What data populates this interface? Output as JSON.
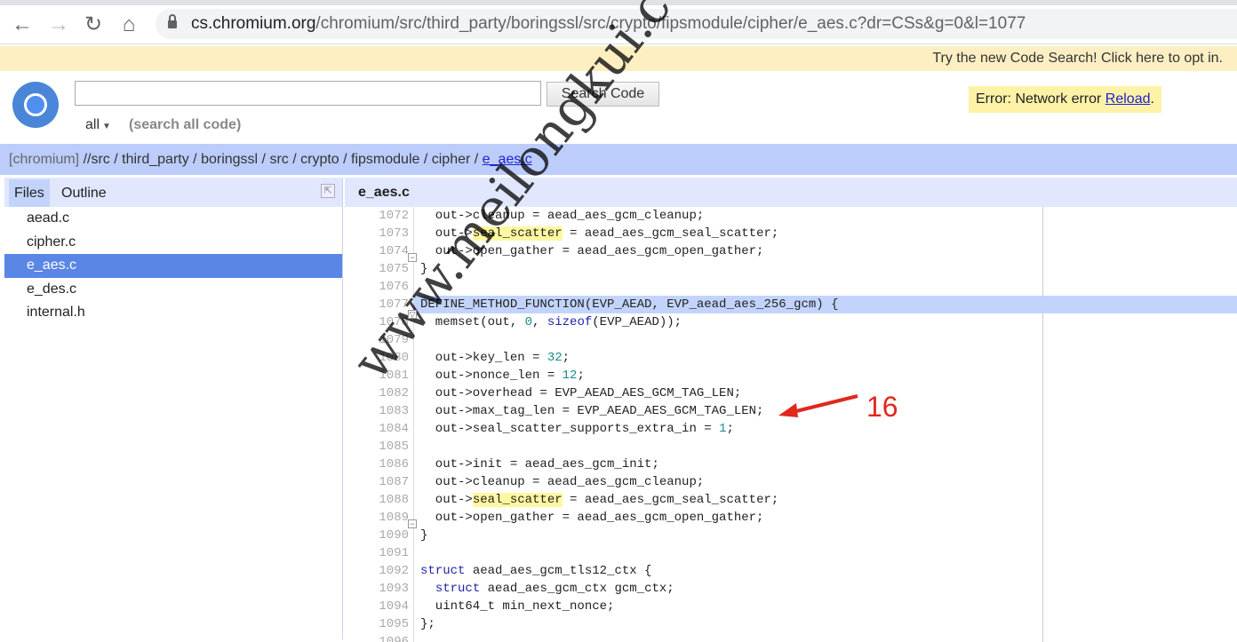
{
  "browser": {
    "url_host": "cs.chromium.org",
    "url_path": "/chromium/src/third_party/boringssl/src/crypto/fipsmodule/cipher/e_aes.c?dr=CSs&g=0&l=1077"
  },
  "banner": "Try the new Code Search! Click here to opt in.",
  "search": {
    "value": "",
    "button": "Search Code",
    "scope": "all",
    "hint": "(search all code)"
  },
  "error": {
    "text": "Error: Network error ",
    "link": "Reload",
    "suffix": "."
  },
  "breadcrumb": {
    "root": "[chromium]",
    "parts": [
      " //src",
      " / third_party",
      " / boringssl",
      " / src",
      " / crypto",
      " / fipsmodule",
      " / cipher",
      " / "
    ],
    "current": "e_aes.c"
  },
  "left_panel": {
    "tabs": [
      "Files",
      "Outline"
    ],
    "files": [
      "aead.c",
      "cipher.c",
      "e_aes.c",
      "e_des.c",
      "internal.h"
    ],
    "selected": "e_aes.c"
  },
  "editor": {
    "filename": "e_aes.c",
    "current_line": 1077,
    "lines": [
      {
        "n": 1072,
        "t": [
          [
            "  out->cleanup = aead_aes_gcm_cleanup;",
            ""
          ]
        ]
      },
      {
        "n": 1073,
        "t": [
          [
            "  out->",
            ""
          ],
          [
            "seal_scatter",
            "hl"
          ],
          [
            " = aead_aes_gcm_seal_scatter;",
            ""
          ]
        ]
      },
      {
        "n": 1074,
        "t": [
          [
            "  out->open_gather = aead_aes_gcm_open_gather;",
            ""
          ]
        ]
      },
      {
        "n": 1075,
        "t": [
          [
            "}",
            ""
          ]
        ]
      },
      {
        "n": 1076,
        "t": []
      },
      {
        "n": 1077,
        "t": [
          [
            "DEFINE_METHOD_FUNCTION(EVP_AEAD, EVP_aead_aes_256_gcm) {",
            ""
          ]
        ]
      },
      {
        "n": 1078,
        "t": [
          [
            "  memset(out, ",
            ""
          ],
          [
            "0",
            "num"
          ],
          [
            ", ",
            ""
          ],
          [
            "sizeof",
            "kw"
          ],
          [
            "(EVP_AEAD));",
            ""
          ]
        ]
      },
      {
        "n": 1079,
        "t": []
      },
      {
        "n": 1080,
        "t": [
          [
            "  out->key_len = ",
            ""
          ],
          [
            "32",
            "num"
          ],
          [
            ";",
            ""
          ]
        ]
      },
      {
        "n": 1081,
        "t": [
          [
            "  out->nonce_len = ",
            ""
          ],
          [
            "12",
            "num"
          ],
          [
            ";",
            ""
          ]
        ]
      },
      {
        "n": 1082,
        "t": [
          [
            "  out->overhead = EVP_AEAD_AES_GCM_TAG_LEN;",
            ""
          ]
        ]
      },
      {
        "n": 1083,
        "t": [
          [
            "  out->max_tag_len = EVP_AEAD_AES_GCM_TAG_LEN;",
            ""
          ]
        ]
      },
      {
        "n": 1084,
        "t": [
          [
            "  out->seal_scatter_supports_extra_in = ",
            ""
          ],
          [
            "1",
            "num"
          ],
          [
            ";",
            ""
          ]
        ]
      },
      {
        "n": 1085,
        "t": []
      },
      {
        "n": 1086,
        "t": [
          [
            "  out->init = aead_aes_gcm_init;",
            ""
          ]
        ]
      },
      {
        "n": 1087,
        "t": [
          [
            "  out->cleanup = aead_aes_gcm_cleanup;",
            ""
          ]
        ]
      },
      {
        "n": 1088,
        "t": [
          [
            "  out->",
            ""
          ],
          [
            "seal_scatter",
            "hl"
          ],
          [
            " = aead_aes_gcm_seal_scatter;",
            ""
          ]
        ]
      },
      {
        "n": 1089,
        "t": [
          [
            "  out->open_gather = aead_aes_gcm_open_gather;",
            ""
          ]
        ]
      },
      {
        "n": 1090,
        "t": [
          [
            "}",
            ""
          ]
        ]
      },
      {
        "n": 1091,
        "t": []
      },
      {
        "n": 1092,
        "t": [
          [
            "struct",
            "kw"
          ],
          [
            " aead_aes_gcm_tls12_ctx {",
            ""
          ]
        ]
      },
      {
        "n": 1093,
        "t": [
          [
            "  ",
            ""
          ],
          [
            "struct",
            "kw"
          ],
          [
            " aead_aes_gcm_ctx gcm_ctx;",
            ""
          ]
        ]
      },
      {
        "n": 1094,
        "t": [
          [
            "  uint64_t min_next_nonce;",
            ""
          ]
        ]
      },
      {
        "n": 1095,
        "t": [
          [
            "};",
            ""
          ]
        ]
      },
      {
        "n": 1096,
        "t": []
      }
    ]
  },
  "watermark": "www.meilongkui.com",
  "annotation": {
    "label": "16",
    "color": "#e0281e"
  },
  "colors": {
    "breadcrumb_bg": "#bccdfc",
    "panel_header": "#e1e8fd",
    "selected_file": "#5a86e6",
    "current_line": "#c3d4fc",
    "highlight": "#fff8a0"
  }
}
